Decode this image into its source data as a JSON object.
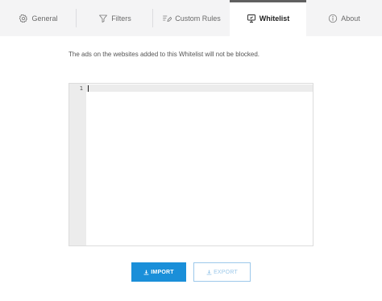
{
  "tabs": [
    {
      "label": "General",
      "icon": "gear-icon",
      "active": false
    },
    {
      "label": "Filters",
      "icon": "filter-icon",
      "active": false
    },
    {
      "label": "Custom Rules",
      "icon": "edit-list-icon",
      "active": false
    },
    {
      "label": "Whitelist",
      "icon": "monitor-icon",
      "active": true
    },
    {
      "label": "About",
      "icon": "info-icon",
      "active": false
    }
  ],
  "description": "The ads on the websites added to this Whitelist will not be blocked.",
  "editor": {
    "line_numbers": [
      "1"
    ],
    "content": ""
  },
  "buttons": {
    "import_label": "IMPORT",
    "export_label": "EXPORT"
  },
  "colors": {
    "accent": "#1a8fd9",
    "export_outline": "#9cc8ea",
    "tabbar_bg": "#f4f4f5",
    "active_tab_border": "#606060"
  }
}
